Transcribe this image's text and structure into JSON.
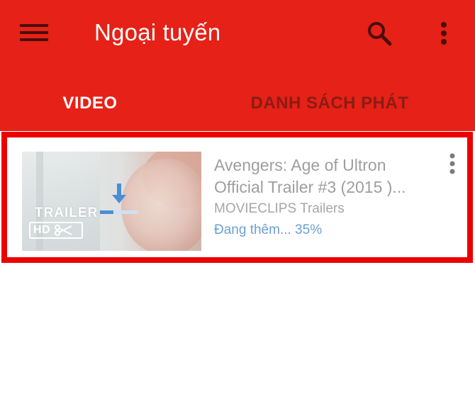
{
  "header": {
    "title": "Ngoại tuyến",
    "menu_icon": "hamburger-menu-icon",
    "search_icon": "search-icon",
    "more_icon": "more-vert-icon",
    "background": "#e62117"
  },
  "tabs": [
    {
      "label": "VIDEO",
      "active": true
    },
    {
      "label": "DANH SÁCH PHÁT",
      "active": false
    }
  ],
  "videos": [
    {
      "title_line1": "Avengers: Age of Ultron",
      "title_line2": "Official Trailer #3 (2015 )...",
      "channel": "MOVIECLIPS Trailers",
      "status": "Đang thêm... 35%",
      "progress_percent": 35,
      "thumbnail": {
        "trailer_label": "TRAILER",
        "hd_label": "HD",
        "overlay_icon": "download-arrow-icon"
      },
      "more_icon": "more-vert-icon"
    }
  ],
  "colors": {
    "accent_red": "#e62117",
    "highlight_border": "#ec0000",
    "status_blue": "#6c9fd2"
  }
}
